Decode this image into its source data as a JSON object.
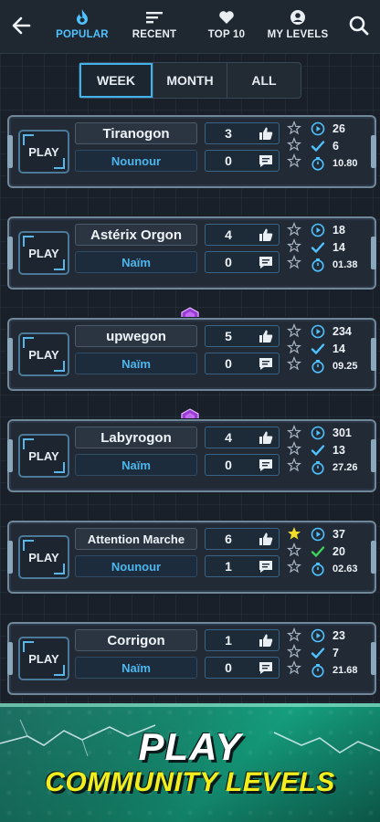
{
  "nav": {
    "tabs": [
      {
        "label": "POPULAR",
        "icon": "flame-icon",
        "active": true
      },
      {
        "label": "RECENT",
        "icon": "sort-lines-icon",
        "active": false
      },
      {
        "label": "TOP 10",
        "icon": "heart-icon",
        "active": false
      },
      {
        "label": "MY LEVELS",
        "icon": "user-circle-icon",
        "active": false
      }
    ]
  },
  "period": {
    "options": [
      "WEEK",
      "MONTH",
      "ALL"
    ],
    "selected": "WEEK"
  },
  "levels": [
    {
      "play": "PLAY",
      "name": "Tiranogon",
      "author": "Nounour",
      "likes": "3",
      "comments": "0",
      "plays": "26",
      "completions": "6",
      "time": "10.80",
      "stars_filled": 0,
      "featured": false
    },
    {
      "play": "PLAY",
      "name": "Astérix Orgon",
      "author": "Naïm",
      "likes": "4",
      "comments": "0",
      "plays": "18",
      "completions": "14",
      "time": "01.38",
      "stars_filled": 0,
      "featured": false
    },
    {
      "play": "PLAY",
      "name": "upwegon",
      "author": "Naïm",
      "likes": "5",
      "comments": "0",
      "plays": "234",
      "completions": "14",
      "time": "09.25",
      "stars_filled": 0,
      "featured": true
    },
    {
      "play": "PLAY",
      "name": "Labyrogon",
      "author": "Naïm",
      "likes": "4",
      "comments": "0",
      "plays": "301",
      "completions": "13",
      "time": "27.26",
      "stars_filled": 0,
      "featured": true
    },
    {
      "play": "PLAY",
      "name": "Attention Marche",
      "author": "Nounour",
      "likes": "6",
      "comments": "1",
      "plays": "37",
      "completions": "20",
      "time": "02.63",
      "stars_filled": 1,
      "featured": false
    },
    {
      "play": "PLAY",
      "name": "Corrigon",
      "author": "Naïm",
      "likes": "1",
      "comments": "0",
      "plays": "23",
      "completions": "7",
      "time": "21.68",
      "stars_filled": 0,
      "featured": false
    }
  ],
  "banner": {
    "line1": "PLAY",
    "line2": "COMMUNITY LEVELS"
  },
  "colors": {
    "accent": "#4fc2ff",
    "author": "#4cb6ec",
    "star_filled": "#f2dd2b",
    "check_green": "#3ed35a",
    "banner_text": "#f2ee1e",
    "glow": "#a03cdc"
  }
}
